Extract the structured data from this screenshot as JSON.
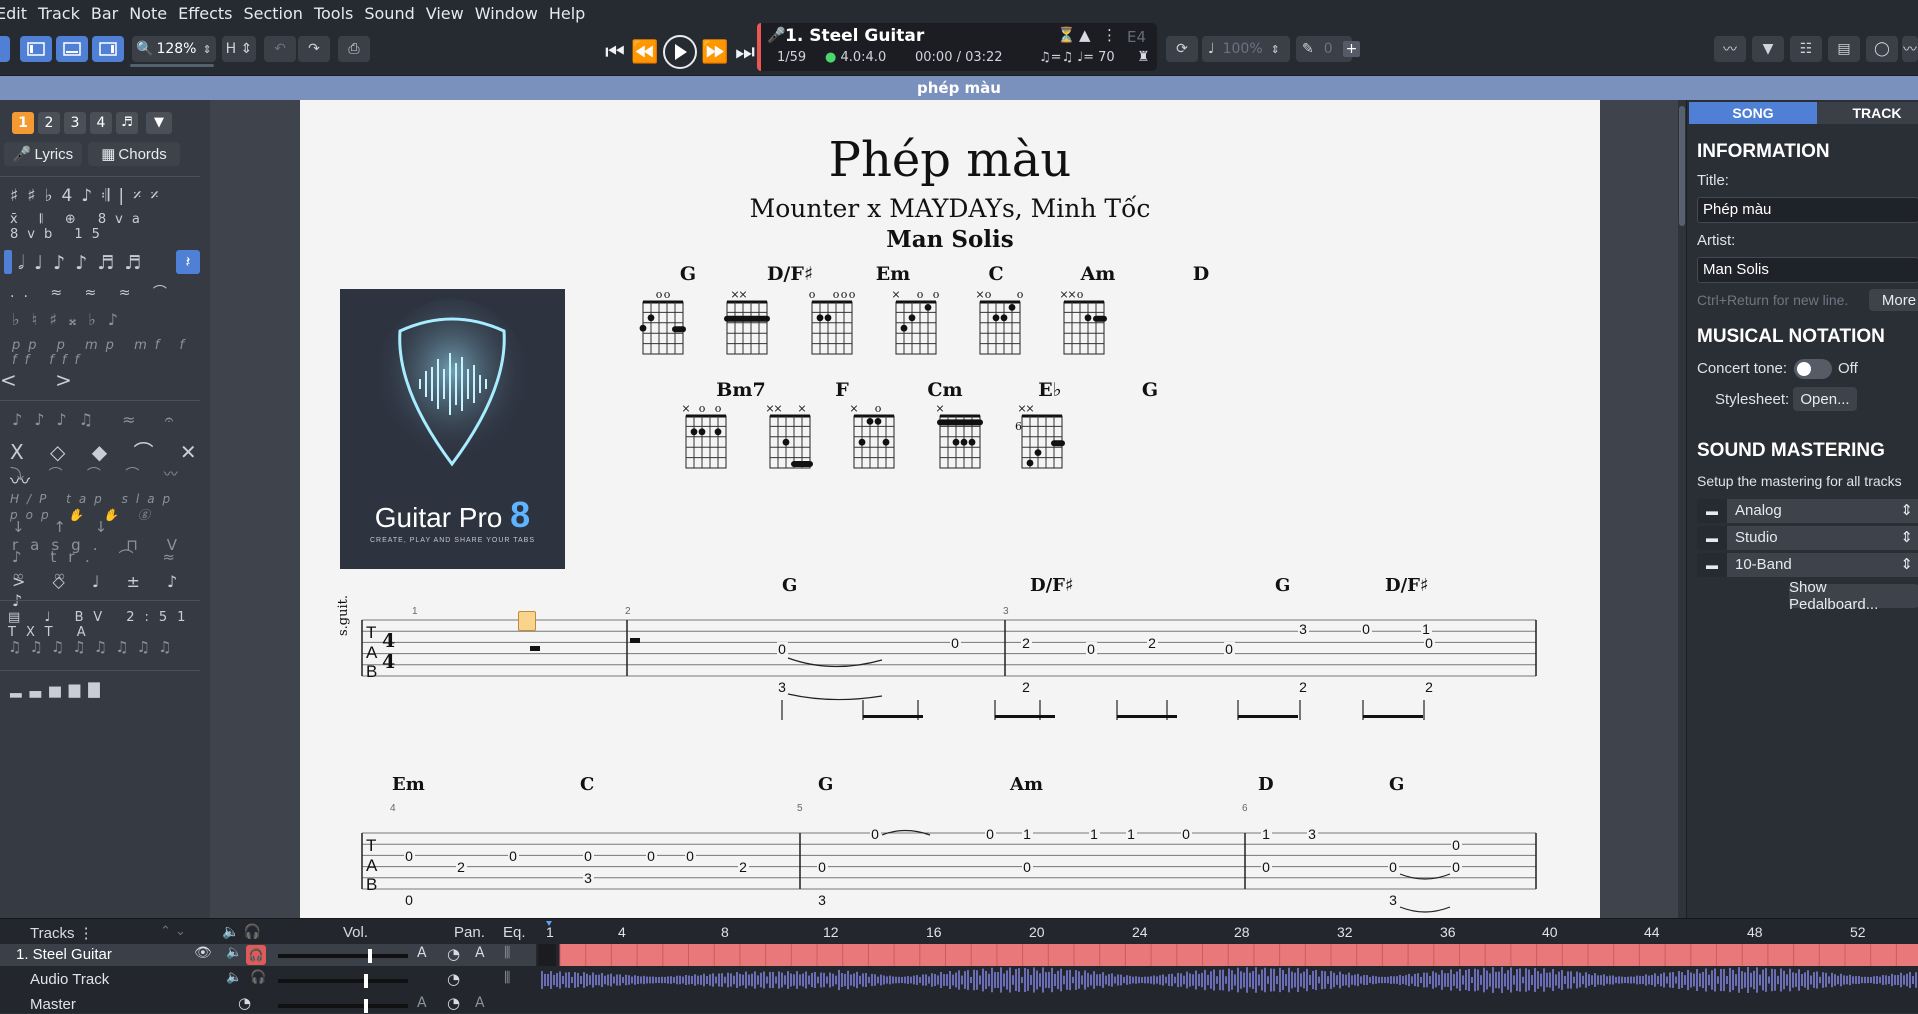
{
  "menu": [
    "Edit",
    "Track",
    "Bar",
    "Note",
    "Effects",
    "Section",
    "Tools",
    "Sound",
    "View",
    "Window",
    "Help"
  ],
  "toolbar": {
    "zoom": "128%",
    "speed": "100%",
    "capo": "0"
  },
  "lcd": {
    "track_name": "1. Steel Guitar",
    "bar_pos": "1/59",
    "time_sig": "4.0:4.0",
    "time": "00:00 / 03:22",
    "tempo_sym": "♫=♫",
    "tempo": "♩= 70",
    "tuning": "E4"
  },
  "banner": "phép màu",
  "leftpanel": {
    "voices": [
      "1",
      "2",
      "3",
      "4"
    ],
    "lyrics": "Lyrics",
    "chords": "Chords"
  },
  "score": {
    "title": "Phép màu",
    "subtitle": "Mounter x MAYDAYs, Minh Tốc",
    "arranger": "Man Solis",
    "chord_row1": [
      "G",
      "D/F♯",
      "Em",
      "C",
      "Am",
      "D"
    ],
    "chord_row2": [
      "Bm7",
      "F",
      "Cm",
      "E♭",
      "G"
    ],
    "chord_row2_fret": "6",
    "album": {
      "brand": "Guitar Pro",
      "version": "8",
      "tagline": "CREATE, PLAY AND SHARE YOUR TABS"
    },
    "instrument": "s.guit.",
    "system1": {
      "bar_numbers": [
        "1",
        "2",
        "3"
      ],
      "chords": [
        "G",
        "D/F♯",
        "G",
        "D/F♯"
      ],
      "frets": [
        "0",
        "3",
        "0",
        "2",
        "2",
        "0",
        "2",
        "0",
        "3",
        "0",
        "1",
        "0",
        "2",
        "2"
      ]
    },
    "system2": {
      "bar_numbers": [
        "4",
        "5",
        "6"
      ],
      "chords": [
        "Em",
        "C",
        "G",
        "Am",
        "D",
        "G"
      ],
      "frets": [
        "0",
        "0",
        "2",
        "0",
        "0",
        "3",
        "0",
        "0",
        "2",
        "0",
        "3",
        "0",
        "0",
        "1",
        "0",
        "1",
        "1",
        "0",
        "1",
        "3",
        "0",
        "0",
        "0",
        "3",
        "0"
      ]
    }
  },
  "rightpanel": {
    "tabs": [
      "SONG",
      "TRACK"
    ],
    "info_title": "INFORMATION",
    "title_label": "Title:",
    "title_value": "Phép màu",
    "artist_label": "Artist:",
    "artist_value": "Man Solis",
    "hint": "Ctrl+Return for new line.",
    "more": "More",
    "notation_title": "MUSICAL NOTATION",
    "concert_tone": "Concert tone:",
    "off": "Off",
    "stylesheet": "Stylesheet:",
    "open": "Open...",
    "mastering_title": "SOUND MASTERING",
    "mastering_desc": "Setup the mastering for all tracks",
    "masters": [
      "Analog",
      "Studio",
      "10-Band"
    ],
    "pedalboard": "Show Pedalboard..."
  },
  "tracks": {
    "header": "Tracks",
    "vol": "Vol.",
    "pan": "Pan.",
    "eq": "Eq.",
    "timeline": [
      "1",
      "4",
      "8",
      "12",
      "16",
      "20",
      "24",
      "28",
      "32",
      "36",
      "40",
      "44",
      "48",
      "52"
    ],
    "rows": [
      "1. Steel Guitar",
      "Audio Track",
      "Master"
    ]
  },
  "colors": {
    "accent": "#4f80d6",
    "selection": "#f59a32",
    "track_region": "#e8787a",
    "waveform": "#7d7fd8",
    "banner": "#7a90bd"
  }
}
